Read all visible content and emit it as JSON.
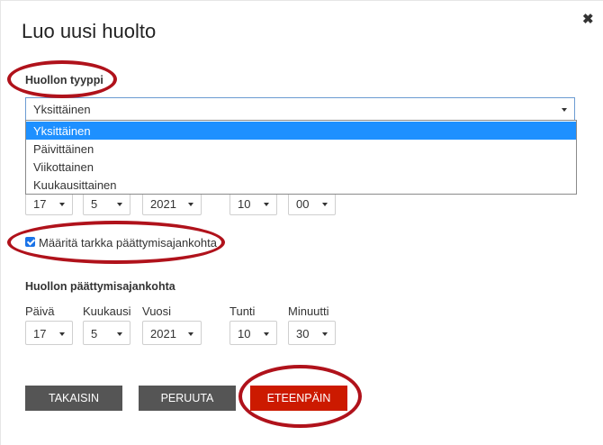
{
  "dialog": {
    "title": "Luo uusi huolto"
  },
  "type_section": {
    "label": "Huollon tyyppi",
    "selected": "Yksittäinen",
    "options": [
      "Yksittäinen",
      "Päivittäinen",
      "Viikottainen",
      "Kuukausittainen"
    ]
  },
  "start": {
    "day": "17",
    "month": "5",
    "year": "2021",
    "hour": "10",
    "minute": "00"
  },
  "checkbox": {
    "label": "Määritä tarkka päättymisajankohta",
    "checked": true
  },
  "end_section": {
    "title": "Huollon päättymisajankohta",
    "labels": {
      "day": "Päivä",
      "month": "Kuukausi",
      "year": "Vuosi",
      "hour": "Tunti",
      "minute": "Minuutti"
    },
    "values": {
      "day": "17",
      "month": "5",
      "year": "2021",
      "hour": "10",
      "minute": "30"
    }
  },
  "buttons": {
    "back": "TAKAISIN",
    "cancel": "PERUUTA",
    "next": "ETEENPÄIN"
  },
  "colors": {
    "primary_button": "#cc1a00",
    "secondary_button": "#555555",
    "highlight": "#1e90ff",
    "annotation": "#b0121b"
  }
}
